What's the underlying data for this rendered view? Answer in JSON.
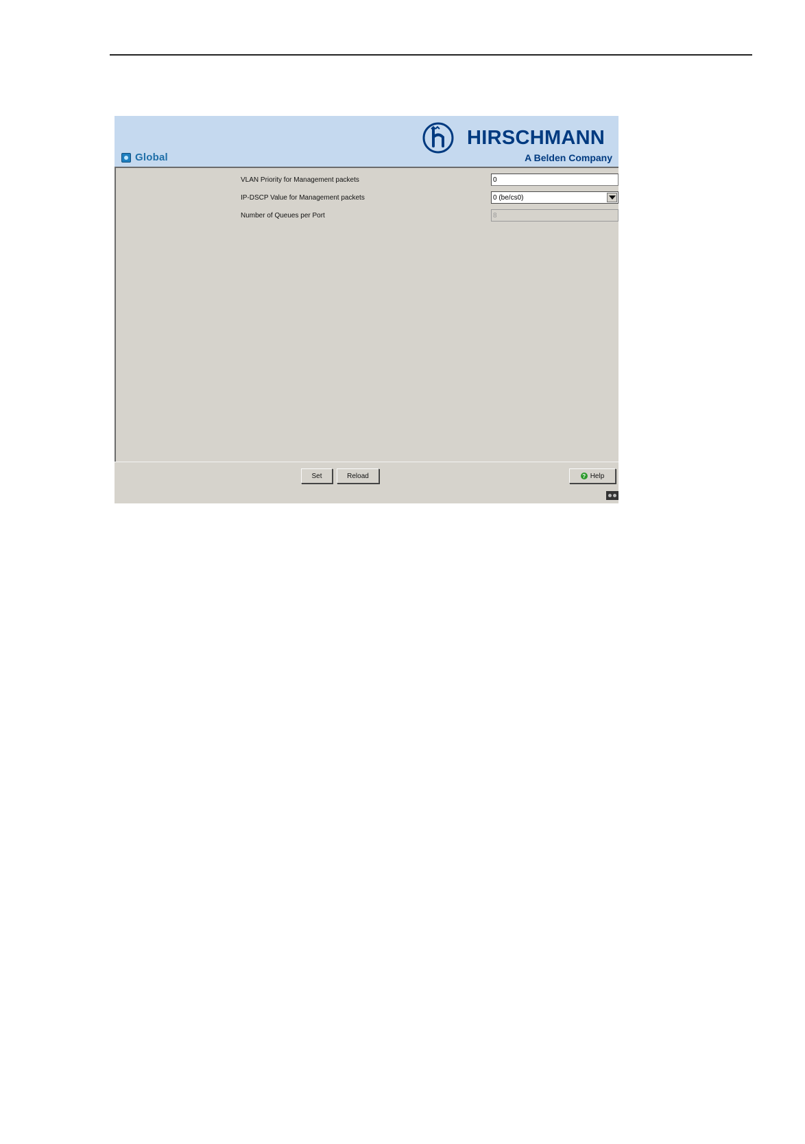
{
  "header": {
    "title": "Global",
    "brand": "HIRSCHMANN",
    "brand_sub": "A Belden Company",
    "brand_color": "#003a80"
  },
  "form": {
    "vlan_priority": {
      "label": "VLAN Priority for Management packets",
      "value": "0"
    },
    "ip_dscp": {
      "label": "IP-DSCP Value for Management packets",
      "value": "0 (be/cs0)"
    },
    "queues": {
      "label": "Number of Queues per Port",
      "value": "8"
    }
  },
  "footer": {
    "set_label": "Set",
    "reload_label": "Reload",
    "help_label": "Help"
  },
  "icons": {
    "title": "globe-icon",
    "logo": "hirschmann-logo-icon",
    "help": "help-icon",
    "status": "status-icon"
  }
}
